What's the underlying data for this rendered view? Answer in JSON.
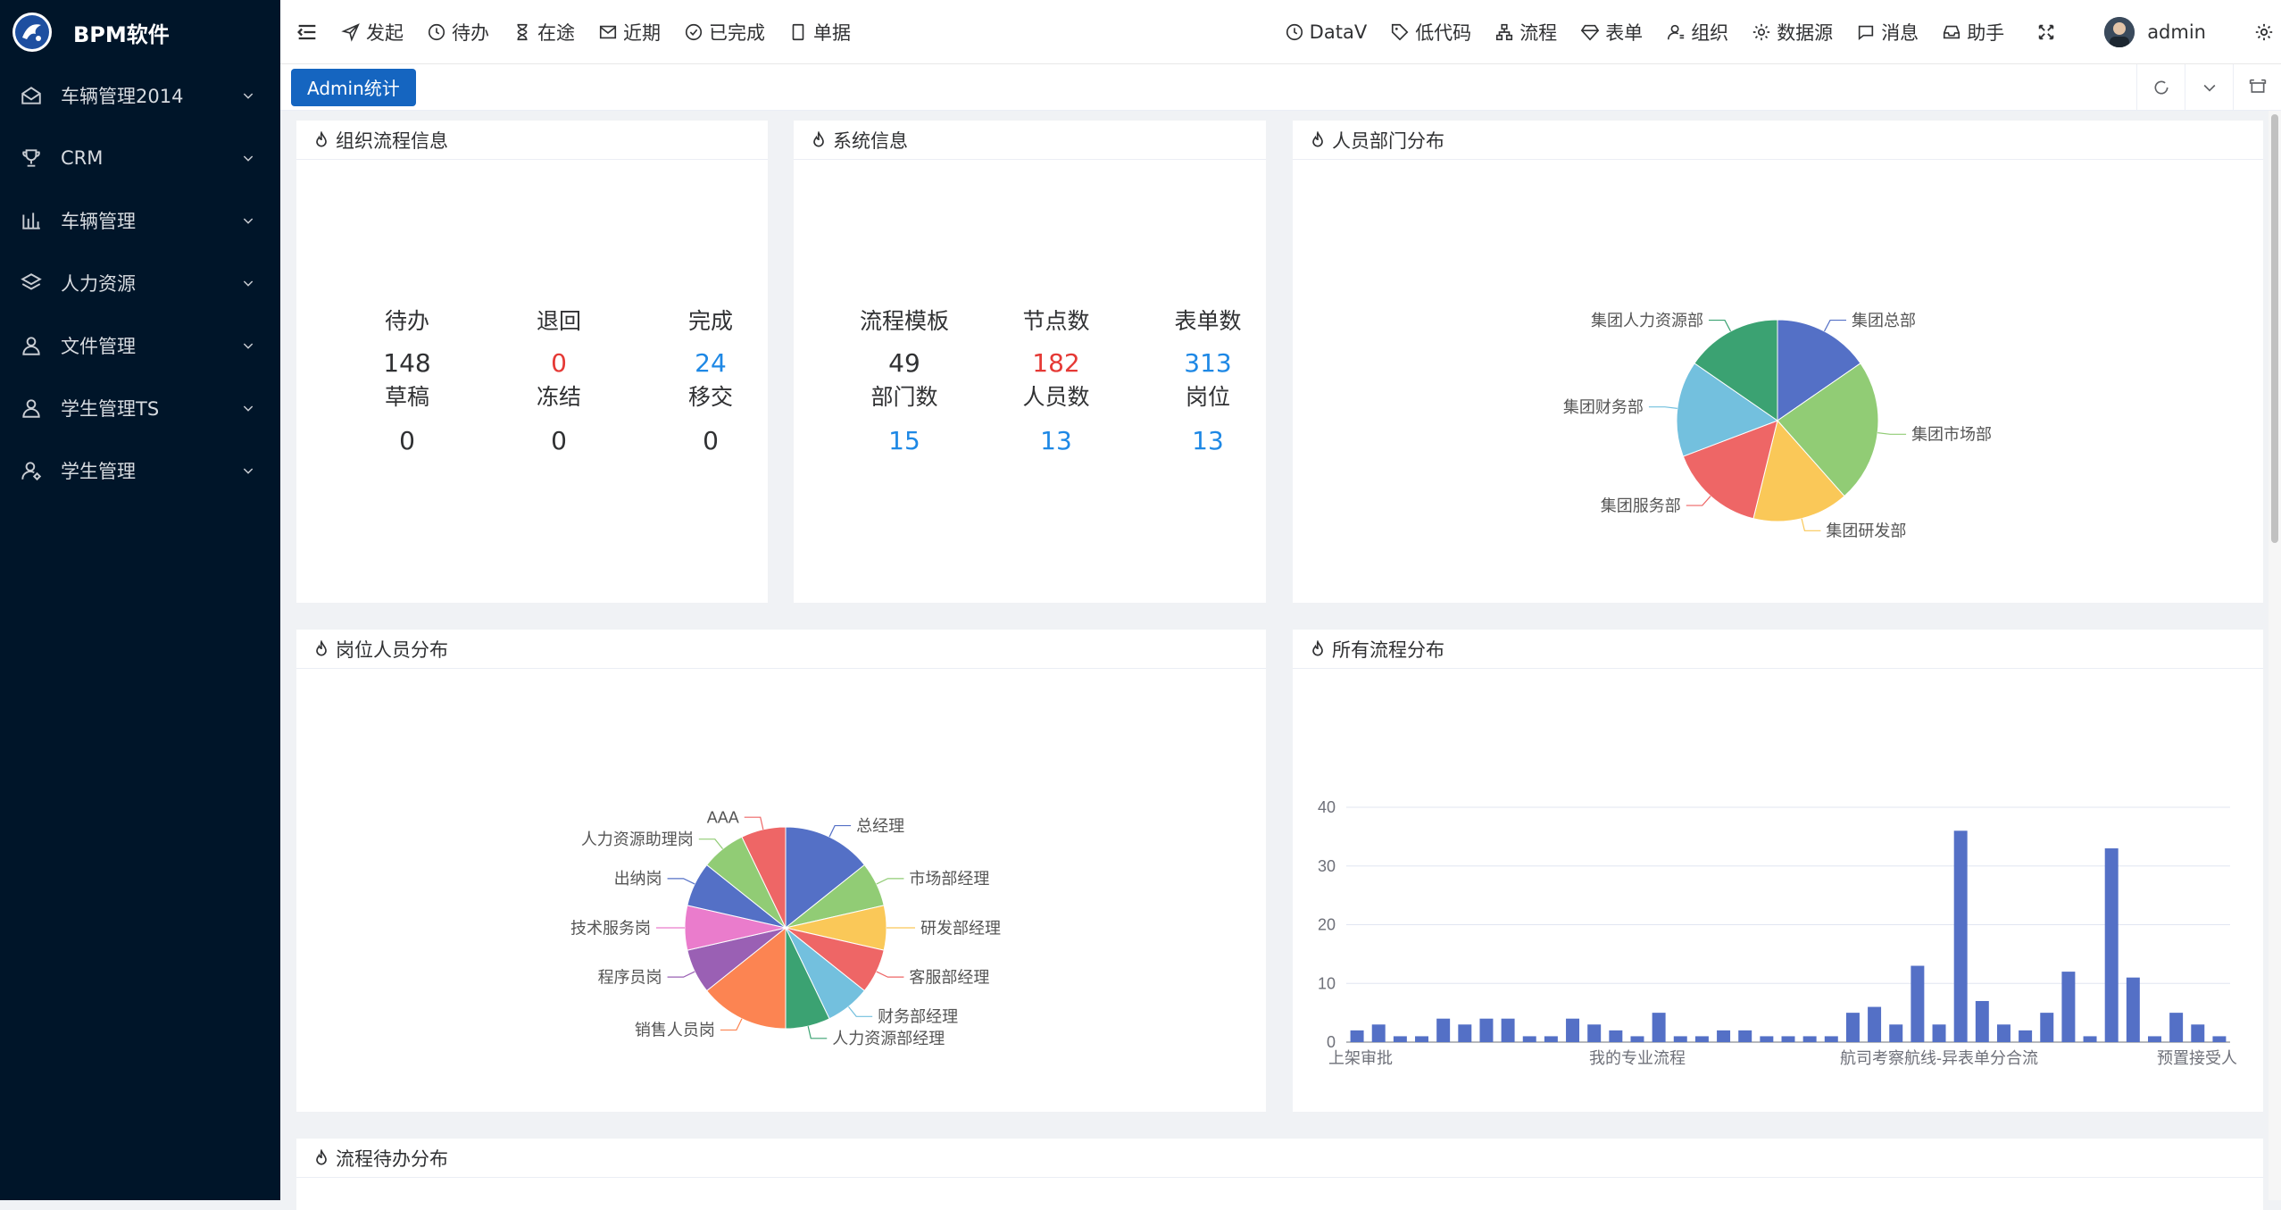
{
  "sidebar": {
    "title": "BPM软件",
    "items": [
      {
        "label": "车辆管理2014",
        "icon": "mail-open-icon"
      },
      {
        "label": "CRM",
        "icon": "trophy-icon"
      },
      {
        "label": "车辆管理",
        "icon": "bar-chart-icon"
      },
      {
        "label": "人力资源",
        "icon": "layers-icon"
      },
      {
        "label": "文件管理",
        "icon": "user-icon"
      },
      {
        "label": "学生管理TS",
        "icon": "user-icon"
      },
      {
        "label": "学生管理",
        "icon": "user-settings-icon"
      }
    ]
  },
  "topnav": {
    "left": [
      {
        "label": "发起",
        "icon": "send-icon"
      },
      {
        "label": "待办",
        "icon": "clock-icon"
      },
      {
        "label": "在途",
        "icon": "hourglass-icon"
      },
      {
        "label": "近期",
        "icon": "mail-icon"
      },
      {
        "label": "已完成",
        "icon": "check-circle-icon"
      },
      {
        "label": "单据",
        "icon": "document-icon"
      }
    ],
    "right": [
      {
        "label": "DataV",
        "icon": "clock-icon"
      },
      {
        "label": "低代码",
        "icon": "tag-icon"
      },
      {
        "label": "流程",
        "icon": "flow-icon"
      },
      {
        "label": "表单",
        "icon": "diamond-icon"
      },
      {
        "label": "组织",
        "icon": "org-user-icon"
      },
      {
        "label": "数据源",
        "icon": "gear-icon"
      },
      {
        "label": "消息",
        "icon": "chat-icon"
      },
      {
        "label": "助手",
        "icon": "inbox-icon"
      }
    ],
    "username": "admin"
  },
  "tags": {
    "active": "Admin统计"
  },
  "cards": {
    "org_flow": {
      "title": "组织流程信息",
      "stats": [
        {
          "label": "待办",
          "value": "148",
          "color": "#303133"
        },
        {
          "label": "退回",
          "value": "0",
          "color": "#e53935"
        },
        {
          "label": "完成",
          "value": "24",
          "color": "#1e88e5"
        },
        {
          "label": "草稿",
          "value": "0",
          "color": "#303133"
        },
        {
          "label": "冻结",
          "value": "0",
          "color": "#303133"
        },
        {
          "label": "移交",
          "value": "0",
          "color": "#303133"
        }
      ]
    },
    "system": {
      "title": "系统信息",
      "stats": [
        {
          "label": "流程模板",
          "value": "49",
          "color": "#303133"
        },
        {
          "label": "节点数",
          "value": "182",
          "color": "#e53935"
        },
        {
          "label": "表单数",
          "value": "313",
          "color": "#1e88e5"
        },
        {
          "label": "部门数",
          "value": "15",
          "color": "#1e88e5"
        },
        {
          "label": "人员数",
          "value": "13",
          "color": "#1e88e5"
        },
        {
          "label": "岗位",
          "value": "13",
          "color": "#1e88e5"
        }
      ]
    },
    "dept": {
      "title": "人员部门分布"
    },
    "post": {
      "title": "岗位人员分布"
    },
    "allflow": {
      "title": "所有流程分布"
    },
    "pending": {
      "title": "流程待办分布"
    }
  },
  "chart_data": [
    {
      "type": "pie",
      "categories": [
        "集团总部",
        "集团市场部",
        "集团研发部",
        "集团服务部",
        "集团财务部",
        "集团人力资源部"
      ],
      "values": [
        2,
        3,
        2,
        2,
        2,
        2
      ],
      "colors": [
        "#5470c6",
        "#91cc75",
        "#fac858",
        "#ee6666",
        "#73c0de",
        "#3ba272"
      ]
    },
    {
      "type": "pie",
      "categories": [
        "总经理",
        "市场部经理",
        "研发部经理",
        "客服部经理",
        "财务部经理",
        "人力资源部经理",
        "销售人员岗",
        "程序员岗",
        "技术服务岗",
        "出纳岗",
        "人力资源助理岗",
        "AAA"
      ],
      "values": [
        2,
        1,
        1,
        1,
        1,
        1,
        2,
        1,
        1,
        1,
        1,
        1
      ],
      "colors": [
        "#5470c6",
        "#91cc75",
        "#fac858",
        "#ee6666",
        "#73c0de",
        "#3ba272",
        "#fc8452",
        "#9a60b4",
        "#ea7ccc",
        "#5470c6",
        "#91cc75",
        "#ee6666"
      ]
    },
    {
      "type": "bar",
      "x_labels_shown": [
        "上架审批",
        "我的专业流程",
        "航司考察航线-异表单分合流",
        "预置接受人"
      ],
      "values": [
        2,
        3,
        1,
        1,
        4,
        3,
        4,
        4,
        1,
        1,
        4,
        3,
        2,
        1,
        5,
        1,
        1,
        2,
        2,
        1,
        1,
        1,
        1,
        5,
        6,
        3,
        13,
        3,
        36,
        7,
        3,
        2,
        5,
        12,
        1,
        33,
        11,
        1,
        5,
        3,
        1
      ],
      "yticks": [
        0,
        10,
        20,
        30,
        40
      ],
      "ylim": [
        0,
        40
      ],
      "color": "#5470c6"
    }
  ]
}
